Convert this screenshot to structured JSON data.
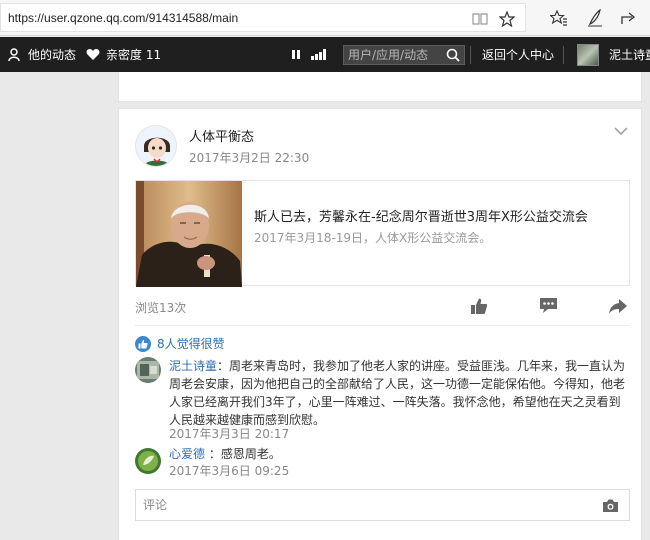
{
  "browser": {
    "url": "https://user.qzone.qq.com/914314588/main",
    "icons": [
      "reading-view-icon",
      "favorite-star-icon",
      "favorites-list-icon",
      "pen-note-icon",
      "share-icon"
    ]
  },
  "nav": {
    "my_feeds": "他的动态",
    "intimacy": "亲密度 11",
    "search_placeholder": "用户/应用/动态",
    "back_home": "返回个人中心",
    "username": "泥土诗童"
  },
  "post": {
    "author": "人体平衡态",
    "time": "2017年3月2日 22:30",
    "share": {
      "title": "斯人已去，芳馨永在-纪念周尔晋逝世3周年X形公益交流会",
      "desc": "2017年3月18-19日，人体X形公益交流会。"
    },
    "views": "浏览13次",
    "likes": "8人觉得很赞"
  },
  "comments": [
    {
      "name": "泥土诗童",
      "sep": "：",
      "text": "周老来青岛时，我参加了他老人家的讲座。受益匪浅。几年来，我一直认为周老会安康，因为他把自己的全部献给了人民，这一功德一定能保佑他。今得知，他老人家已经离开我们3年了，心里一阵难过、一阵失落。我怀念他，希望他在天之灵看到人民越来越健康而感到欣慰。",
      "time": "2017年3月3日 20:17"
    },
    {
      "name": "心爱德",
      "sep": " ：",
      "text": "感恩周老。",
      "time": "2017年3月6日 09:25"
    }
  ],
  "comment_box": {
    "placeholder": "评论"
  },
  "colors": {
    "nav_bg": "#1f1f1f",
    "link_blue": "#2c6fb4",
    "page_bg": "#e9e9e9"
  }
}
